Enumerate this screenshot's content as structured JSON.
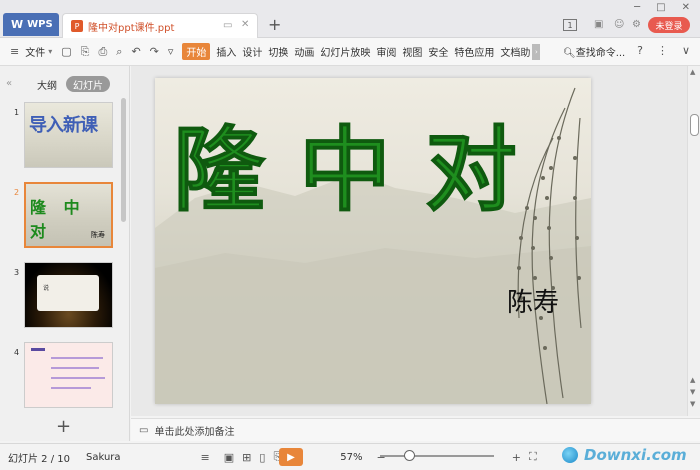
{
  "titlebar": {
    "app_tab": "WPS",
    "doc_tab": "隆中对ppt课件.ppt",
    "badge": "1",
    "login": "未登录",
    "add_tab": "+"
  },
  "menubar": {
    "file": "文件",
    "tabs": [
      "开始",
      "插入",
      "设计",
      "切换",
      "动画",
      "幻灯片放映",
      "审阅",
      "视图",
      "安全",
      "特色应用",
      "文档助"
    ],
    "search": "查找命令..."
  },
  "left_panel": {
    "tab_outline": "大纲",
    "tab_slides": "幻灯片",
    "thumbs": [
      {
        "num": "1",
        "text": "导入新课"
      },
      {
        "num": "2",
        "text": "隆 中 对",
        "sub": "陈寿"
      },
      {
        "num": "3",
        "text": "说"
      },
      {
        "num": "4",
        "text": ""
      }
    ],
    "add": "+"
  },
  "slide": {
    "title": "隆中对",
    "author": "陈寿"
  },
  "notes": {
    "placeholder": "单击此处添加备注"
  },
  "status": {
    "slide_count": "幻灯片 2 / 10",
    "theme": "Sakura",
    "zoom": "57%",
    "zoom_fraction": 0.25,
    "watermark": "Downxi.com"
  },
  "colors": {
    "accent": "#e8863a",
    "title_green": "#1e8e1e",
    "wps_blue": "#4a6fb5",
    "login_red": "#e85a4f"
  }
}
